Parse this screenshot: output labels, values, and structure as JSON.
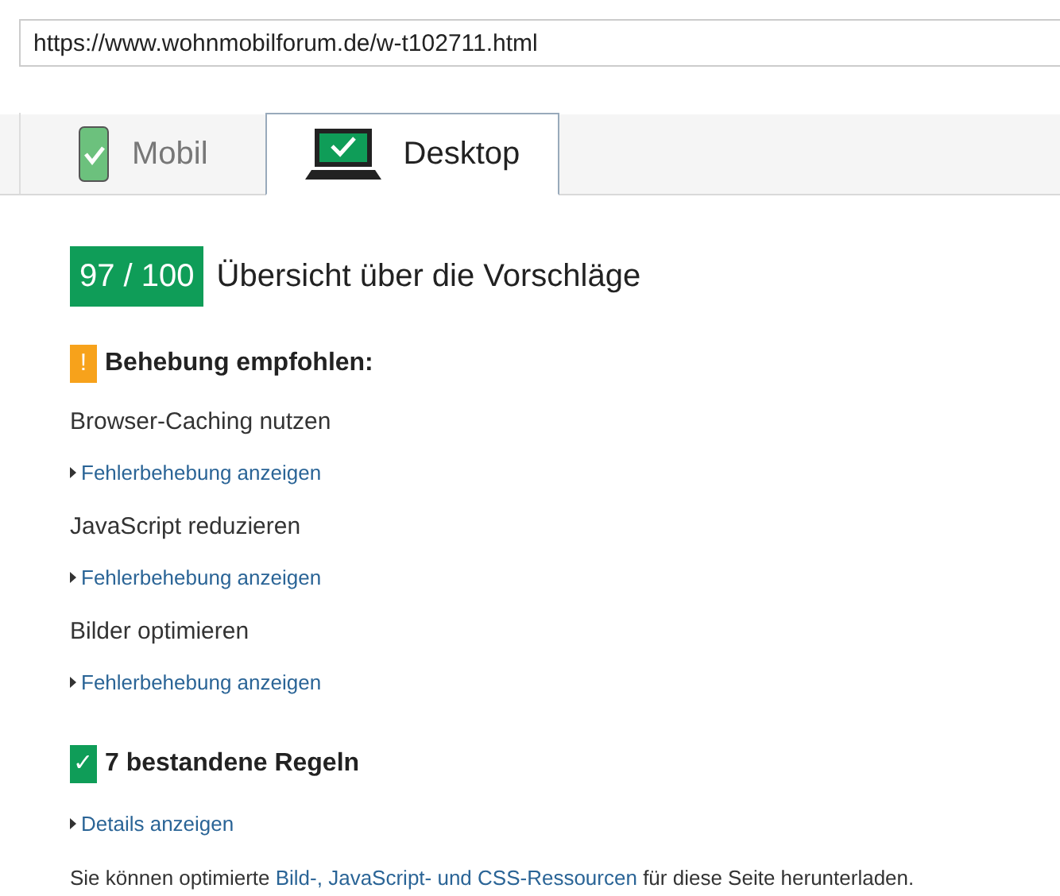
{
  "url_field": {
    "value": "https://www.wohnmobilforum.de/w-t102711.html"
  },
  "tabs": [
    {
      "label": "Mobil",
      "kind": "phone",
      "selected": false
    },
    {
      "label": "Desktop",
      "kind": "laptop",
      "selected": true
    }
  ],
  "score": {
    "value": "97 / 100",
    "title": "Übersicht über die Vorschläge"
  },
  "sections": [
    {
      "kind": "warning",
      "icon": "!",
      "heading": "Behebung empfohlen:",
      "items": [
        {
          "title": "Browser-Caching nutzen",
          "link": "Fehlerbehebung anzeigen"
        },
        {
          "title": "JavaScript reduzieren",
          "link": "Fehlerbehebung anzeigen"
        },
        {
          "title": "Bilder optimieren",
          "link": "Fehlerbehebung anzeigen"
        }
      ]
    },
    {
      "kind": "passed",
      "icon": "✓",
      "heading": "7 bestandene Regeln",
      "items": [
        {
          "link": "Details anzeigen"
        }
      ]
    }
  ],
  "footer": {
    "before": "Sie können optimierte ",
    "link": "Bild-, JavaScript- und CSS-Ressourcen",
    "after": " für diese Seite herunterladen."
  }
}
